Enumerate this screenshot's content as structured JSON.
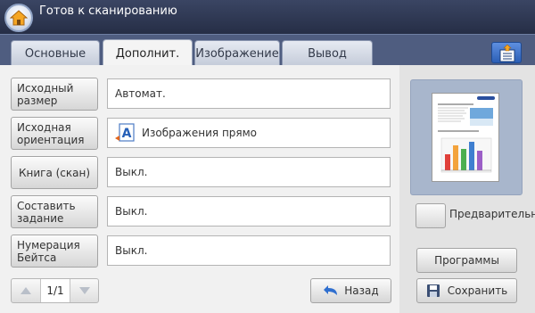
{
  "header": {
    "title": "Готов к сканированию",
    "home_icon": "home-icon"
  },
  "tabs": [
    {
      "label": "Основные",
      "active": false
    },
    {
      "label": "Дополнит.",
      "active": true
    },
    {
      "label": "Изображение",
      "active": false
    },
    {
      "label": "Вывод",
      "active": false
    }
  ],
  "tab_tool_icon": "job-settings-icon",
  "options": [
    {
      "label": "Исходный размер",
      "value": "Автомат."
    },
    {
      "label": "Исходная ориентация",
      "value": "Изображения прямо",
      "icon": "orientation-icon"
    },
    {
      "label": "Книга (скан)",
      "value": "Выкл."
    },
    {
      "label": "Составить задание",
      "value": "Выкл."
    },
    {
      "label": "Нумерация Бейтса",
      "value": "Выкл."
    }
  ],
  "pager": {
    "indicator": "1/1"
  },
  "buttons": {
    "back": "Назад",
    "preview": "Предварительный просмотр",
    "programs": "Программы",
    "save": "Сохранить"
  },
  "colors": {
    "topbar": "#2f3a56",
    "tabstrip": "#4f5d80",
    "tool_button": "#3a70cc",
    "preview_frame": "#a8b6cc"
  }
}
